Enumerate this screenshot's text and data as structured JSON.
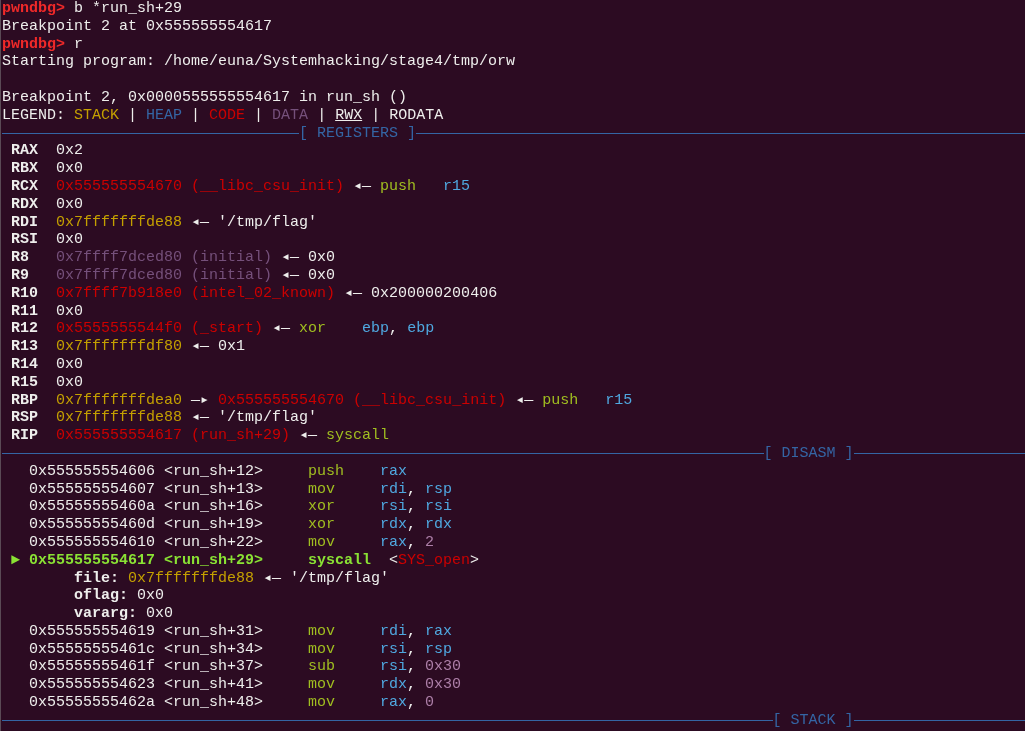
{
  "terminal": {
    "history": [
      {
        "kind": "prompt",
        "prompt": "pwndbg>",
        "command": "b *run_sh+29"
      },
      {
        "kind": "output",
        "text": "Breakpoint 2 at 0x555555554617"
      },
      {
        "kind": "prompt",
        "prompt": "pwndbg>",
        "command": "r"
      },
      {
        "kind": "output",
        "text": "Starting program: /home/euna/Systemhacking/stage4/tmp/orw"
      },
      {
        "kind": "blank"
      },
      {
        "kind": "output",
        "text": "Breakpoint 2, 0x0000555555554617 in run_sh ()"
      }
    ],
    "legend": {
      "label": "LEGEND:",
      "items": [
        {
          "text": "STACK",
          "kind": "stack"
        },
        {
          "text": "|",
          "kind": "separator"
        },
        {
          "text": "HEAP",
          "kind": "heap"
        },
        {
          "text": "|",
          "kind": "separator"
        },
        {
          "text": "CODE",
          "kind": "code"
        },
        {
          "text": "|",
          "kind": "separator"
        },
        {
          "text": "DATA",
          "kind": "data"
        },
        {
          "text": "|",
          "kind": "separator"
        },
        {
          "text": "RWX",
          "kind": "rwx"
        },
        {
          "text": "|",
          "kind": "separator"
        },
        {
          "text": "RODATA",
          "kind": "plain"
        }
      ]
    },
    "sections": [
      {
        "title": "[ REGISTERS ]",
        "registers": [
          {
            "name": "RAX",
            "chain": [
              {
                "text": "0x2",
                "kind": "plain"
              }
            ]
          },
          {
            "name": "RBX",
            "chain": [
              {
                "text": "0x0",
                "kind": "plain"
              }
            ]
          },
          {
            "name": "RCX",
            "chain": [
              {
                "text": "0x555555554670",
                "kind": "code"
              },
              {
                "text": "(__libc_csu_init)",
                "kind": "code"
              },
              {
                "text": "◂—",
                "kind": "arrow"
              },
              {
                "text": "push",
                "kind": "mnemonic"
              },
              {
                "text": "r15",
                "kind": "register"
              }
            ]
          },
          {
            "name": "RDX",
            "chain": [
              {
                "text": "0x0",
                "kind": "plain"
              }
            ]
          },
          {
            "name": "RDI",
            "chain": [
              {
                "text": "0x7fffffffde88",
                "kind": "stack"
              },
              {
                "text": "◂—",
                "kind": "arrow"
              },
              {
                "text": "'/tmp/flag'",
                "kind": "plain"
              }
            ]
          },
          {
            "name": "RSI",
            "chain": [
              {
                "text": "0x0",
                "kind": "plain"
              }
            ]
          },
          {
            "name": "R8",
            "chain": [
              {
                "text": "0x7ffff7dced80",
                "kind": "data"
              },
              {
                "text": "(initial)",
                "kind": "data"
              },
              {
                "text": "◂—",
                "kind": "arrow"
              },
              {
                "text": "0x0",
                "kind": "plain"
              }
            ]
          },
          {
            "name": "R9",
            "chain": [
              {
                "text": "0x7ffff7dced80",
                "kind": "data"
              },
              {
                "text": "(initial)",
                "kind": "data"
              },
              {
                "text": "◂—",
                "kind": "arrow"
              },
              {
                "text": "0x0",
                "kind": "plain"
              }
            ]
          },
          {
            "name": "R10",
            "chain": [
              {
                "text": "0x7ffff7b918e0",
                "kind": "code"
              },
              {
                "text": "(intel_02_known)",
                "kind": "code"
              },
              {
                "text": "◂—",
                "kind": "arrow"
              },
              {
                "text": "0x200000200406",
                "kind": "plain"
              }
            ]
          },
          {
            "name": "R11",
            "chain": [
              {
                "text": "0x0",
                "kind": "plain"
              }
            ]
          },
          {
            "name": "R12",
            "chain": [
              {
                "text": "0x5555555544f0",
                "kind": "code"
              },
              {
                "text": "(_start)",
                "kind": "code"
              },
              {
                "text": "◂—",
                "kind": "arrow"
              },
              {
                "text": "xor",
                "kind": "mnemonic"
              },
              {
                "text": "ebp",
                "kind": "register"
              },
              {
                "text": ",",
                "kind": "punct"
              },
              {
                "text": "ebp",
                "kind": "register"
              }
            ]
          },
          {
            "name": "R13",
            "chain": [
              {
                "text": "0x7fffffffdf80",
                "kind": "stack"
              },
              {
                "text": "◂—",
                "kind": "arrow"
              },
              {
                "text": "0x1",
                "kind": "plain"
              }
            ]
          },
          {
            "name": "R14",
            "chain": [
              {
                "text": "0x0",
                "kind": "plain"
              }
            ]
          },
          {
            "name": "R15",
            "chain": [
              {
                "text": "0x0",
                "kind": "plain"
              }
            ]
          },
          {
            "name": "RBP",
            "chain": [
              {
                "text": "0x7fffffffdea0",
                "kind": "stack"
              },
              {
                "text": "—▸",
                "kind": "arrow"
              },
              {
                "text": "0x555555554670",
                "kind": "code"
              },
              {
                "text": "(__libc_csu_init)",
                "kind": "code"
              },
              {
                "text": "◂—",
                "kind": "arrow"
              },
              {
                "text": "push",
                "kind": "mnemonic"
              },
              {
                "text": "r15",
                "kind": "register"
              }
            ]
          },
          {
            "name": "RSP",
            "chain": [
              {
                "text": "0x7fffffffde88",
                "kind": "stack"
              },
              {
                "text": "◂—",
                "kind": "arrow"
              },
              {
                "text": "'/tmp/flag'",
                "kind": "plain"
              }
            ]
          },
          {
            "name": "RIP",
            "chain": [
              {
                "text": "0x555555554617",
                "kind": "code"
              },
              {
                "text": "(run_sh+29)",
                "kind": "code"
              },
              {
                "text": "◂—",
                "kind": "arrow"
              },
              {
                "text": "syscall",
                "kind": "mnemonic"
              }
            ]
          }
        ]
      },
      {
        "title": "[ DISASM ]",
        "instructions": [
          {
            "kind": "instruction",
            "current": false,
            "address": "0x555555554606",
            "symbol": "<run_sh+12>",
            "mnemonic": "push",
            "operands": [
              {
                "text": "rax",
                "kind": "register"
              }
            ]
          },
          {
            "kind": "instruction",
            "current": false,
            "address": "0x555555554607",
            "symbol": "<run_sh+13>",
            "mnemonic": "mov",
            "operands": [
              {
                "text": "rdi",
                "kind": "register"
              },
              {
                "text": ",",
                "kind": "punct"
              },
              {
                "text": "rsp",
                "kind": "register"
              }
            ]
          },
          {
            "kind": "instruction",
            "current": false,
            "address": "0x55555555460a",
            "symbol": "<run_sh+16>",
            "mnemonic": "xor",
            "operands": [
              {
                "text": "rsi",
                "kind": "register"
              },
              {
                "text": ",",
                "kind": "punct"
              },
              {
                "text": "rsi",
                "kind": "register"
              }
            ]
          },
          {
            "kind": "instruction",
            "current": false,
            "address": "0x55555555460d",
            "symbol": "<run_sh+19>",
            "mnemonic": "xor",
            "operands": [
              {
                "text": "rdx",
                "kind": "register"
              },
              {
                "text": ",",
                "kind": "punct"
              },
              {
                "text": "rdx",
                "kind": "register"
              }
            ]
          },
          {
            "kind": "instruction",
            "current": false,
            "address": "0x555555554610",
            "symbol": "<run_sh+22>",
            "mnemonic": "mov",
            "operands": [
              {
                "text": "rax",
                "kind": "register"
              },
              {
                "text": ",",
                "kind": "punct"
              },
              {
                "text": "2",
                "kind": "number"
              }
            ]
          },
          {
            "kind": "instruction",
            "current": true,
            "marker": "►",
            "address": "0x555555554617",
            "symbol": "<run_sh+29>",
            "mnemonic": "syscall",
            "annotation": [
              {
                "text": "<",
                "kind": "plain"
              },
              {
                "text": "SYS_open",
                "kind": "code"
              },
              {
                "text": ">",
                "kind": "plain"
              }
            ]
          },
          {
            "kind": "argument",
            "name": "file:",
            "chain": [
              {
                "text": "0x7fffffffde88",
                "kind": "stack"
              },
              {
                "text": "◂—",
                "kind": "arrow"
              },
              {
                "text": "'/tmp/flag'",
                "kind": "plain"
              }
            ]
          },
          {
            "kind": "argument",
            "name": "oflag:",
            "chain": [
              {
                "text": "0x0",
                "kind": "plain"
              }
            ]
          },
          {
            "kind": "argument",
            "name": "vararg:",
            "chain": [
              {
                "text": "0x0",
                "kind": "plain"
              }
            ]
          },
          {
            "kind": "instruction",
            "current": false,
            "address": "0x555555554619",
            "symbol": "<run_sh+31>",
            "mnemonic": "mov",
            "operands": [
              {
                "text": "rdi",
                "kind": "register"
              },
              {
                "text": ",",
                "kind": "punct"
              },
              {
                "text": "rax",
                "kind": "register"
              }
            ]
          },
          {
            "kind": "instruction",
            "current": false,
            "address": "0x55555555461c",
            "symbol": "<run_sh+34>",
            "mnemonic": "mov",
            "operands": [
              {
                "text": "rsi",
                "kind": "register"
              },
              {
                "text": ",",
                "kind": "punct"
              },
              {
                "text": "rsp",
                "kind": "register"
              }
            ]
          },
          {
            "kind": "instruction",
            "current": false,
            "address": "0x55555555461f",
            "symbol": "<run_sh+37>",
            "mnemonic": "sub",
            "operands": [
              {
                "text": "rsi",
                "kind": "register"
              },
              {
                "text": ",",
                "kind": "punct"
              },
              {
                "text": "0x30",
                "kind": "number"
              }
            ]
          },
          {
            "kind": "instruction",
            "current": false,
            "address": "0x555555554623",
            "symbol": "<run_sh+41>",
            "mnemonic": "mov",
            "operands": [
              {
                "text": "rdx",
                "kind": "register"
              },
              {
                "text": ",",
                "kind": "punct"
              },
              {
                "text": "0x30",
                "kind": "number"
              }
            ]
          },
          {
            "kind": "instruction",
            "current": false,
            "address": "0x55555555462a",
            "symbol": "<run_sh+48>",
            "mnemonic": "mov",
            "operands": [
              {
                "text": "rax",
                "kind": "register"
              },
              {
                "text": ",",
                "kind": "punct"
              },
              {
                "text": "0",
                "kind": "number"
              }
            ]
          }
        ]
      },
      {
        "title": "[ STACK ]"
      }
    ]
  }
}
